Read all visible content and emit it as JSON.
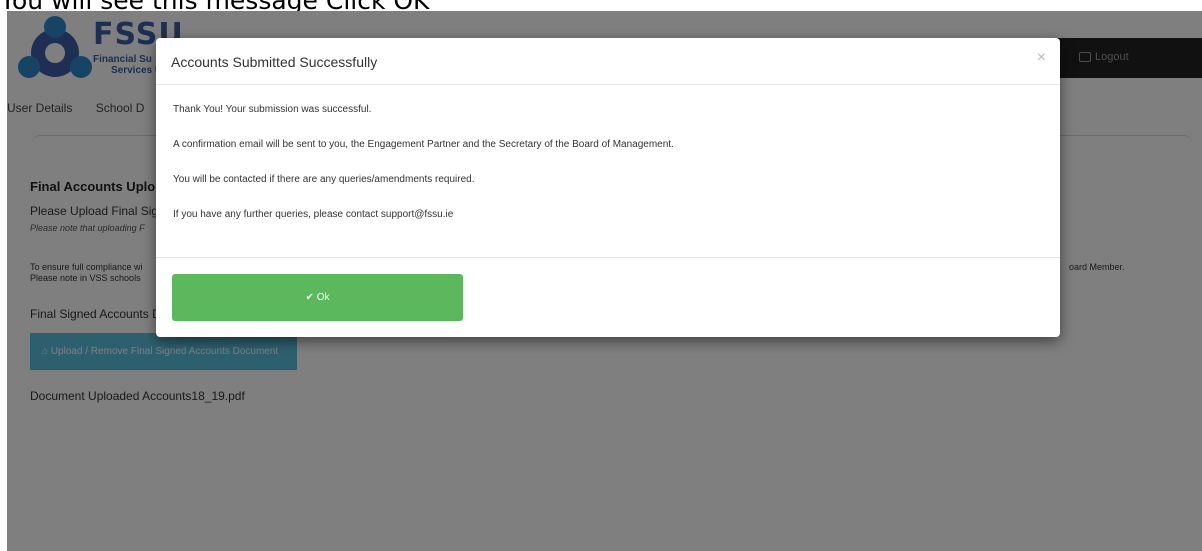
{
  "caption": "You will see this message Click OK",
  "brand": {
    "name": "FSSU",
    "line1": "Financial Su",
    "line2": "Services U"
  },
  "header": {
    "logout_label": "Logout"
  },
  "nav": {
    "items": [
      "User Details",
      "School D"
    ]
  },
  "page": {
    "section_title": "Final Accounts Uplo",
    "upload_prompt": "Please Upload Final Sig",
    "note": "Please note that uploading F",
    "compliance_line": "To ensure full compliance wi",
    "vss_line": "Please note in VSS schools",
    "compliance_tail": "oard Member.",
    "final_doc_label": "Final Signed Accounts D",
    "upload_button": "Upload / Remove Final Signed Accounts Document",
    "document_uploaded": "Document Uploaded Accounts18_19.pdf"
  },
  "modal": {
    "title": "Accounts Submitted Successfully",
    "close": "×",
    "lines": [
      "Thank You! Your submission was successful.",
      "A confirmation email will be sent to you, the Engagement Partner and the Secretary of the Board of Management.",
      "You will be contacted if there are any queries/amendments required.",
      "If you have any further queries, please contact support@fssu.ie"
    ],
    "ok_label": "Ok"
  },
  "colors": {
    "accent_green": "#5cb85c",
    "info_blue": "#5bc0de",
    "brand_blue": "#3b5fa5"
  }
}
